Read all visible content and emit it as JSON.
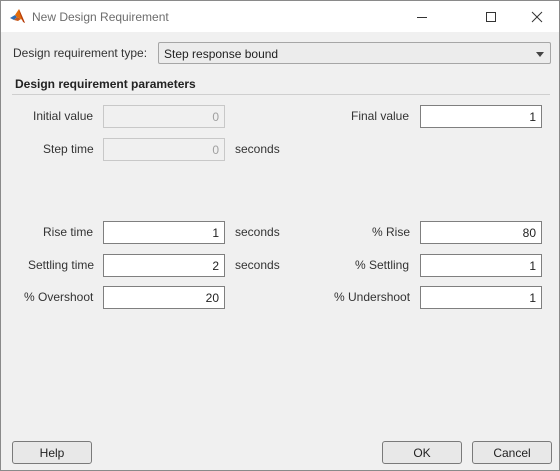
{
  "window": {
    "title": "New Design Requirement",
    "controls": [
      "minimize-icon",
      "maximize-icon",
      "close-icon"
    ]
  },
  "requirement_type": {
    "label": "Design requirement type:",
    "selected": "Step response bound"
  },
  "parameters": {
    "section_title": "Design requirement parameters",
    "initial_value": {
      "label": "Initial value",
      "value": "0"
    },
    "final_value": {
      "label": "Final value",
      "value": "1"
    },
    "step_time": {
      "label": "Step time",
      "value": "0",
      "unit": "seconds"
    },
    "rise_time": {
      "label": "Rise time",
      "value": "1",
      "unit": "seconds"
    },
    "percent_rise": {
      "label": "% Rise",
      "value": "80"
    },
    "settling_time": {
      "label": "Settling time",
      "value": "2",
      "unit": "seconds"
    },
    "percent_settling": {
      "label": "% Settling",
      "value": "1"
    },
    "percent_overshoot": {
      "label": "% Overshoot",
      "value": "20"
    },
    "percent_undershoot": {
      "label": "% Undershoot",
      "value": "1"
    }
  },
  "buttons": {
    "help": "Help",
    "ok": "OK",
    "cancel": "Cancel"
  },
  "colors": {
    "window_bg": "#f0f0f0",
    "titlebar_bg": "#ffffff",
    "field_border": "#7f7f7f",
    "disabled_field_bg": "#f0f0f0"
  }
}
